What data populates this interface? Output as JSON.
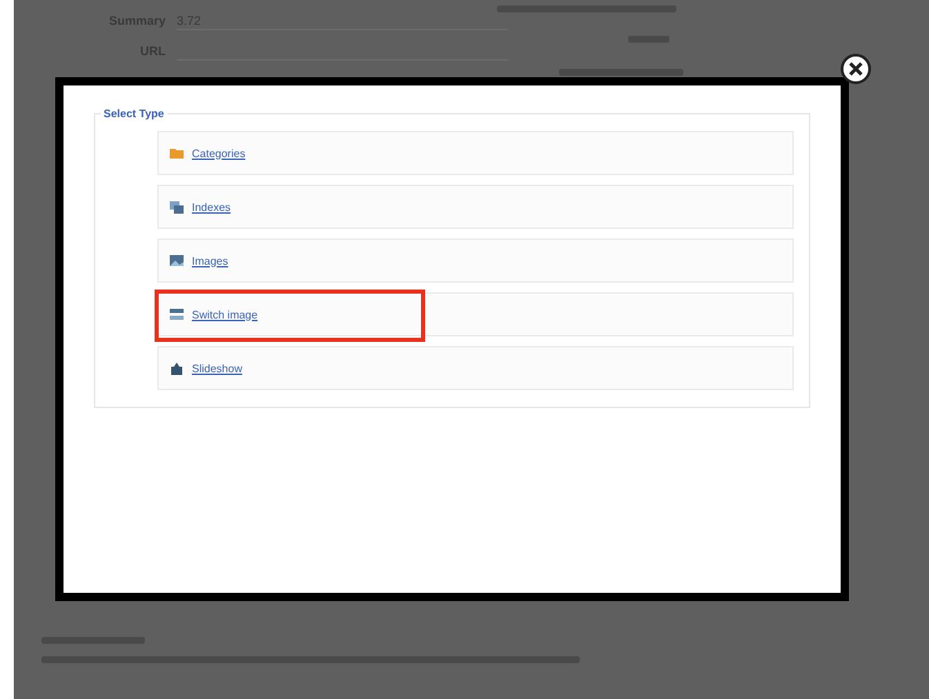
{
  "background": {
    "fields": [
      {
        "label": "Summary",
        "value": "3.72"
      },
      {
        "label": "URL"
      }
    ]
  },
  "modal": {
    "legend": "Select Type",
    "items": [
      {
        "label": "Categories",
        "kind": "folder",
        "highlighted": false
      },
      {
        "label": "Indexes",
        "kind": "index",
        "highlighted": false
      },
      {
        "label": "Images",
        "kind": "image",
        "highlighted": false
      },
      {
        "label": "Switch image",
        "kind": "switch",
        "highlighted": true
      },
      {
        "label": "Slideshow",
        "kind": "slideshow",
        "highlighted": false
      }
    ]
  }
}
